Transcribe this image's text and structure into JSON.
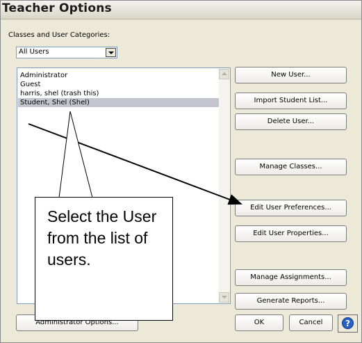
{
  "window": {
    "title": "Teacher Options"
  },
  "classes": {
    "label": "Classes and User Categories:",
    "selected": "All Users"
  },
  "users": {
    "items": [
      {
        "label": "Administrator"
      },
      {
        "label": "Guest"
      },
      {
        "label": "harris, shel (trash this)"
      },
      {
        "label": "Student, Shel (Shel)",
        "selected": true
      }
    ]
  },
  "buttons": {
    "new_user": "New User...",
    "import_student_list": "Import Student List...",
    "delete_user": "Delete User...",
    "manage_classes": "Manage Classes...",
    "edit_user_preferences": "Edit User Preferences...",
    "edit_user_properties": "Edit User Properties...",
    "manage_assignments": "Manage Assignments...",
    "generate_reports": "Generate Reports...",
    "administrator_options": "Administrator Options...",
    "ok": "OK",
    "cancel": "Cancel"
  },
  "callout": {
    "text": "Select the User from the list of users."
  },
  "colors": {
    "dialog_bg": "#ece9d8",
    "selection": "#c4c6cf",
    "help_icon": "#2a5fc4"
  },
  "icons": [
    "dropdown-arrow-icon",
    "scroll-up-icon",
    "scroll-down-icon",
    "help-icon"
  ]
}
